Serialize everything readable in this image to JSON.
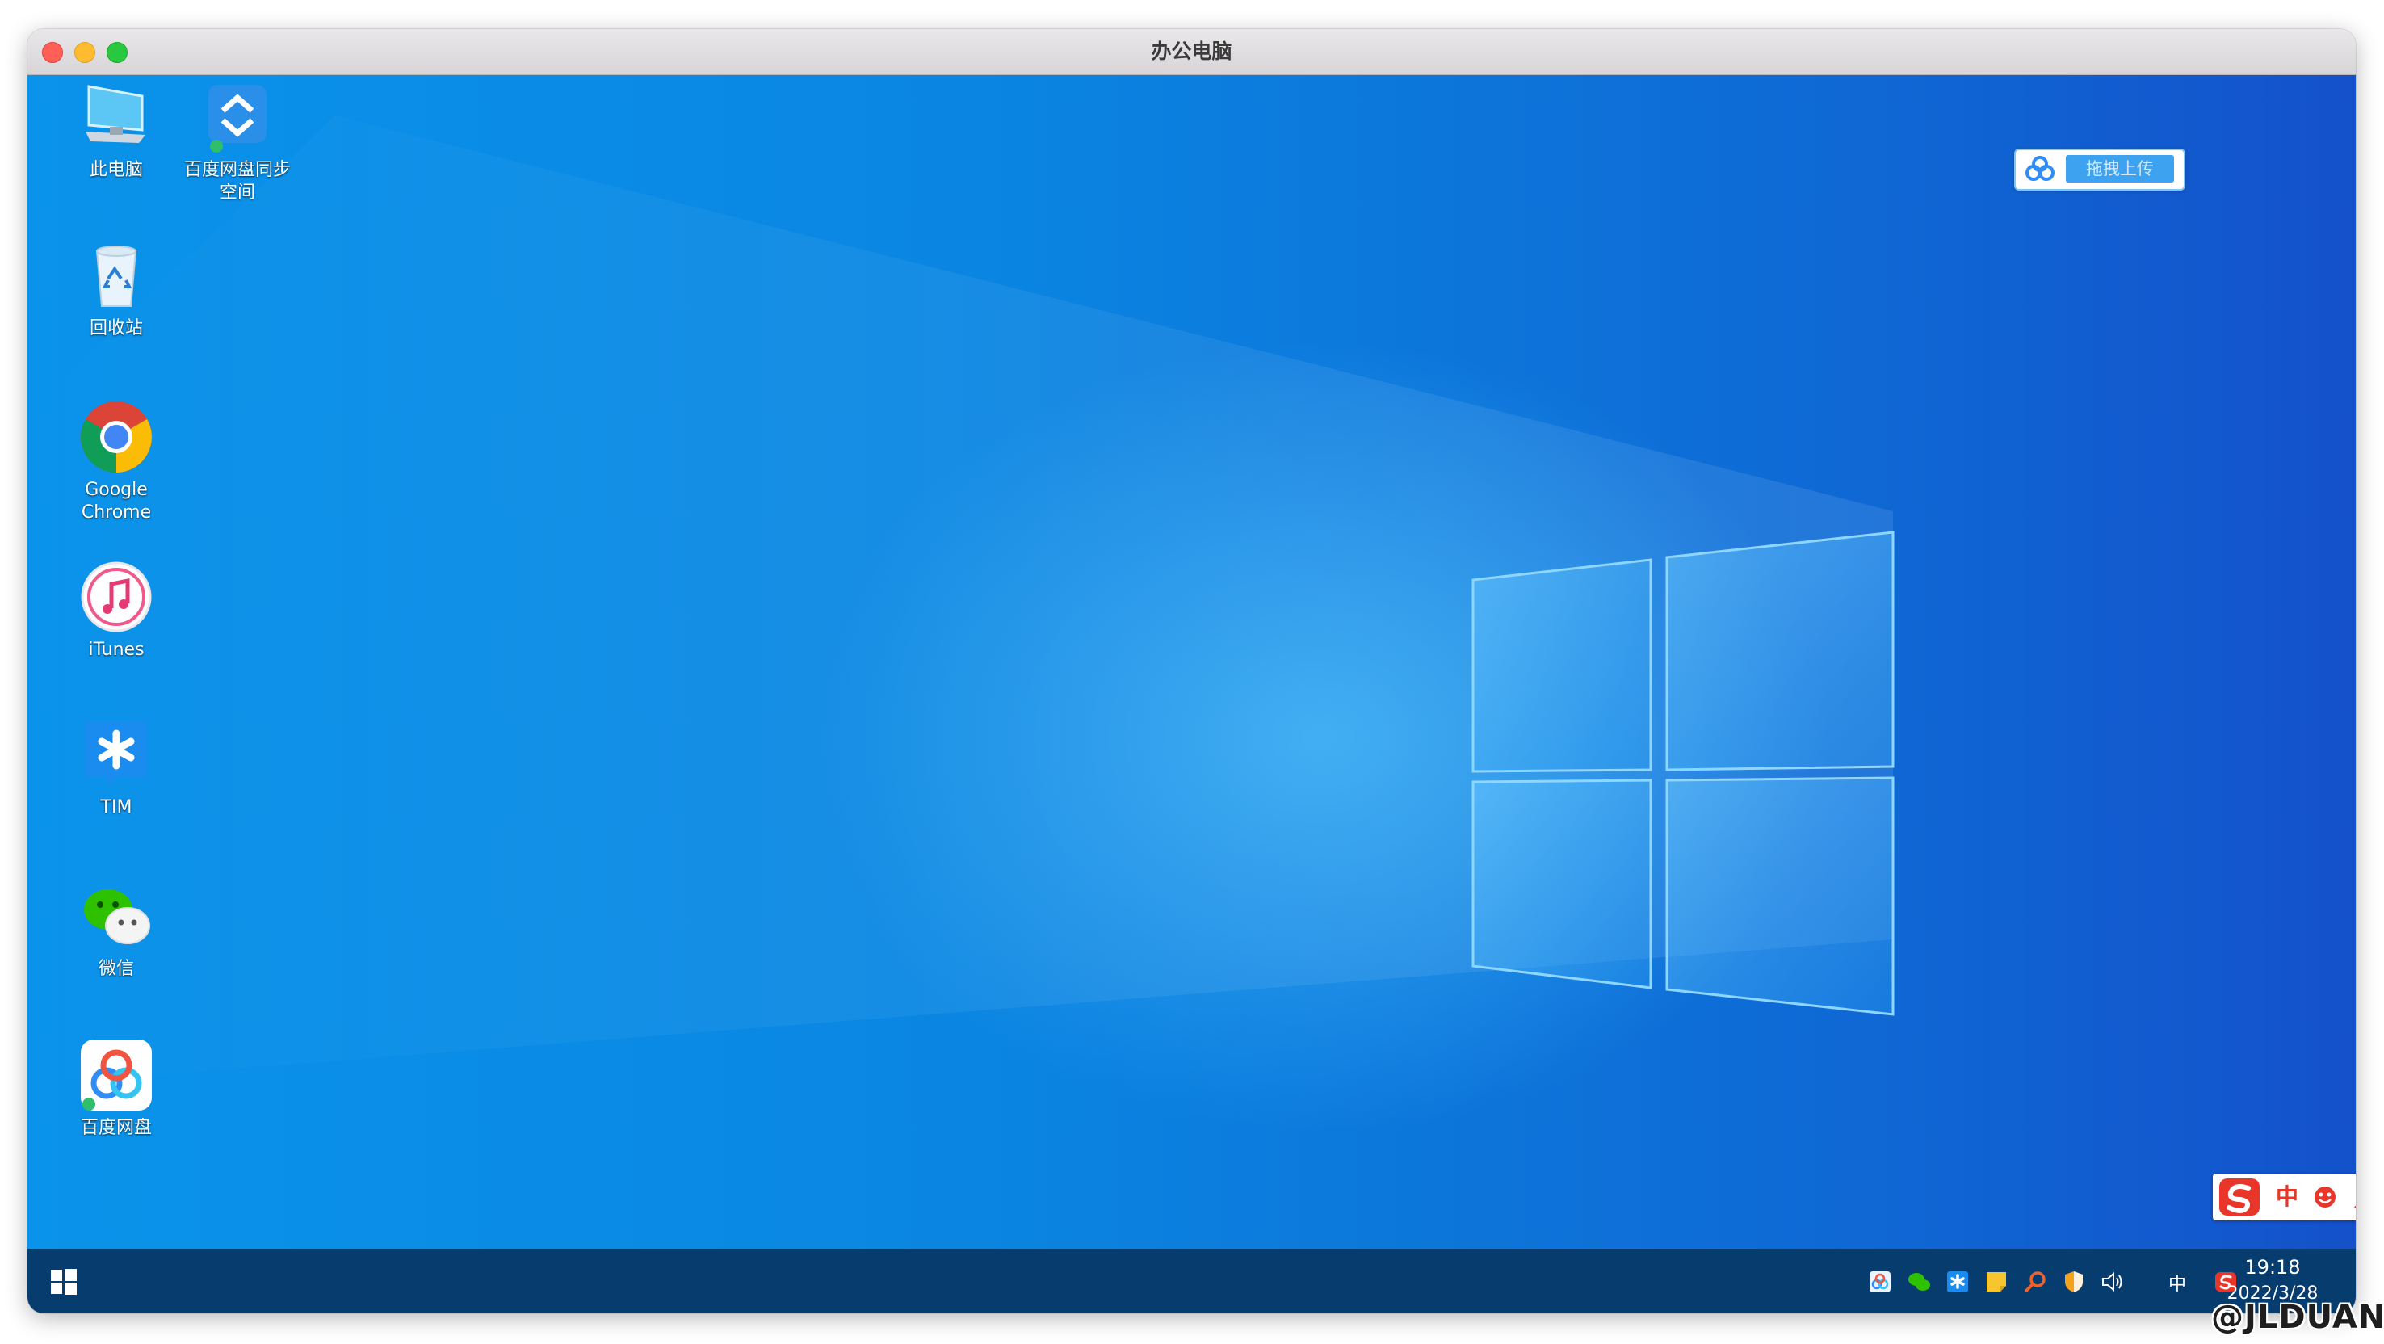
{
  "window": {
    "title": "办公电脑"
  },
  "desktop": {
    "icons": [
      {
        "label": "此电脑",
        "icon": "this-pc-icon"
      },
      {
        "label": "百度网盘同步空间",
        "icon": "baidu-sync-space-icon"
      },
      {
        "label": "回收站",
        "icon": "recycle-bin-icon"
      },
      {
        "label": "Google Chrome",
        "icon": "chrome-icon"
      },
      {
        "label": "iTunes",
        "icon": "itunes-icon"
      },
      {
        "label": "TIM",
        "icon": "tim-icon"
      },
      {
        "label": "微信",
        "icon": "wechat-icon"
      },
      {
        "label": "百度网盘",
        "icon": "baidu-netdisk-icon"
      }
    ],
    "upload_widget": {
      "label": "拖拽上传"
    },
    "ime_bar": {
      "mode": "中"
    }
  },
  "taskbar": {
    "ime_indicator": "中",
    "time": "19:18",
    "date": "2022/3/28"
  },
  "watermark": "@JLDUAN",
  "colors": {
    "desktop_blue": "#0a86e2",
    "taskbar": "#063c6e",
    "sogou_red": "#e8372a"
  }
}
